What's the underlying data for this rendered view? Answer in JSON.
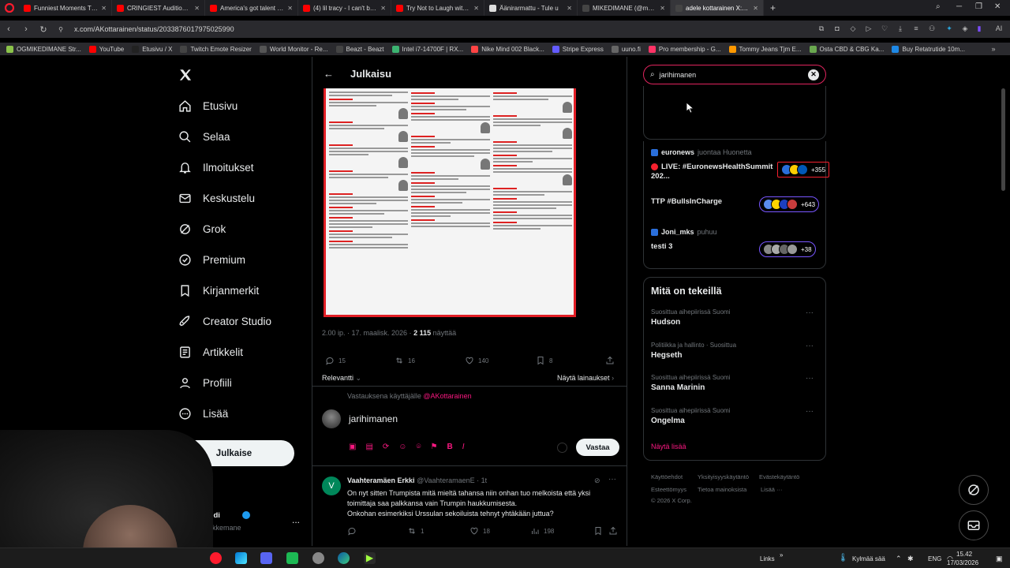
{
  "browser": {
    "tabs": [
      {
        "title": "Funniest Moments That M",
        "color": "#ff0000"
      },
      {
        "title": "CRINGIEST Auditions! Try",
        "color": "#ff0000"
      },
      {
        "title": "America's got talent worst",
        "color": "#ff0000"
      },
      {
        "title": "(4) lil tracy - I can't believe",
        "color": "#ff0000"
      },
      {
        "title": "Try Not to Laugh with KSI",
        "color": "#ff0000"
      },
      {
        "title": "Äänirarmattu - Tule u",
        "color": "#dddddd"
      },
      {
        "title": "MIKEDIMANE (@mmikedi",
        "color": "#444444"
      },
      {
        "title": "adele kottarainen X:ssä: \"",
        "color": "#444444",
        "active": true
      }
    ],
    "new_tab": "+",
    "url": "x.com/AKottarainen/status/2033876017975025990",
    "bookmarks": [
      {
        "label": "OGMIKEDIMANE Str...",
        "color": "#8bc34a"
      },
      {
        "label": "YouTube",
        "color": "#ff0000"
      },
      {
        "label": "Etusivu / X",
        "color": "#222222"
      },
      {
        "label": "Twitch Emote Resizer",
        "color": "#444444"
      },
      {
        "label": "World Monitor - Re...",
        "color": "#555555"
      },
      {
        "label": "Beazt - Beazt",
        "color": "#444444"
      },
      {
        "label": "Intel i7-14700F | RX...",
        "color": "#3cb371"
      },
      {
        "label": "Nike Mind 002 Black...",
        "color": "#ff4444"
      },
      {
        "label": "Stripe Express",
        "color": "#635bff"
      },
      {
        "label": "uuno.fi",
        "color": "#666666"
      },
      {
        "label": "Pro membership - G...",
        "color": "#ff3366"
      },
      {
        "label": "Tommy Jeans Tjm E...",
        "color": "#ff9900"
      },
      {
        "label": "Osta CBD & CBG Ka...",
        "color": "#6aa84f"
      },
      {
        "label": "Buy Retatrutide 10m...",
        "color": "#1e88e5"
      }
    ]
  },
  "sidebar": {
    "items": [
      {
        "label": "Etusivu",
        "icon": "home-icon"
      },
      {
        "label": "Selaa",
        "icon": "search-icon"
      },
      {
        "label": "Ilmoitukset",
        "icon": "bell-icon"
      },
      {
        "label": "Keskustelu",
        "icon": "mail-icon"
      },
      {
        "label": "Grok",
        "icon": "grok-icon"
      },
      {
        "label": "Premium",
        "icon": "verified-icon"
      },
      {
        "label": "Kirjanmerkit",
        "icon": "bookmark-icon"
      },
      {
        "label": "Creator Studio",
        "icon": "rocket-icon"
      },
      {
        "label": "Artikkelit",
        "icon": "article-icon"
      },
      {
        "label": "Profiili",
        "icon": "user-icon"
      },
      {
        "label": "Lisää",
        "icon": "more-circle-icon"
      }
    ],
    "post_button": "Julkaise",
    "account_name": "tedi",
    "account_handle": "nikkemane",
    "account_more": "..."
  },
  "center": {
    "header_title": "Julkaisu",
    "tweet_meta_time": "2.00 ip. · 17. maalisk. 2026 ·",
    "tweet_views_count": "2 115",
    "tweet_views_label": "näyttää",
    "replies": "15",
    "retweets": "16",
    "likes": "140",
    "bookmarks": "8",
    "sort_label": "Relevantti",
    "quotes_link": "Näytä lainaukset",
    "reply_to_prefix": "Vastauksena käyttäjälle",
    "reply_to_handle": "@AKottarainen",
    "compose_text": "jarihimanen",
    "reply_button": "Vastaa",
    "reply": {
      "author": "Vaahteramäen Erkki",
      "handle": "@VaahteramaenE · 1t",
      "text": "On nyt sitten Trumpista mitä mieltä tahansa niin onhan tuo melkoista että yksi toimittaja saa palkkansa vain Trumpin haukkumisesta.\nOnkohan esimerkiksi Urssulan sekoiluista tehnyt yhtäkään juttua?",
      "retweets": "1",
      "likes": "18",
      "views": "198"
    }
  },
  "right": {
    "search_value": "jarihimanen",
    "live": [
      {
        "host": "euronews",
        "action": "juontaa Huonetta",
        "title": "LIVE: #EuronewsHealthSummit 202...",
        "count": "+355",
        "live": true
      },
      {
        "host": "",
        "action": "",
        "title": "TTP #BullsInCharge",
        "count": "+643",
        "live": false
      },
      {
        "host": "Joni_mks",
        "action": "puhuu",
        "title": "testi 3",
        "count": "+38",
        "live": false
      }
    ],
    "trends_title": "Mitä on tekeillä",
    "trends": [
      {
        "category": "Suosittua aihepiirissä Suomi",
        "name": "Hudson"
      },
      {
        "category": "Politiikka ja hallinto · Suosittua",
        "name": "Hegseth"
      },
      {
        "category": "Suosittua aihepiirissä Suomi",
        "name": "Sanna Marinin"
      },
      {
        "category": "Suosittua aihepiirissä Suomi",
        "name": "Ongelma"
      }
    ],
    "show_more": "Näytä lisää",
    "footer": [
      "Käyttöehdot",
      "Yksityisyyskäytäntö",
      "Evästekäytäntö",
      "Esteettömyys",
      "Tietoa mainoksista",
      "Lisää ···",
      "© 2026 X Corp."
    ]
  },
  "taskbar": {
    "links": "Links",
    "weather": "Kylmää sää",
    "lang": "ENG",
    "time": "15.42",
    "date": "17/03/2026"
  },
  "colors": {
    "accent": "#f91880",
    "search_border": "#e0245e",
    "live_red": "#f4212e"
  }
}
